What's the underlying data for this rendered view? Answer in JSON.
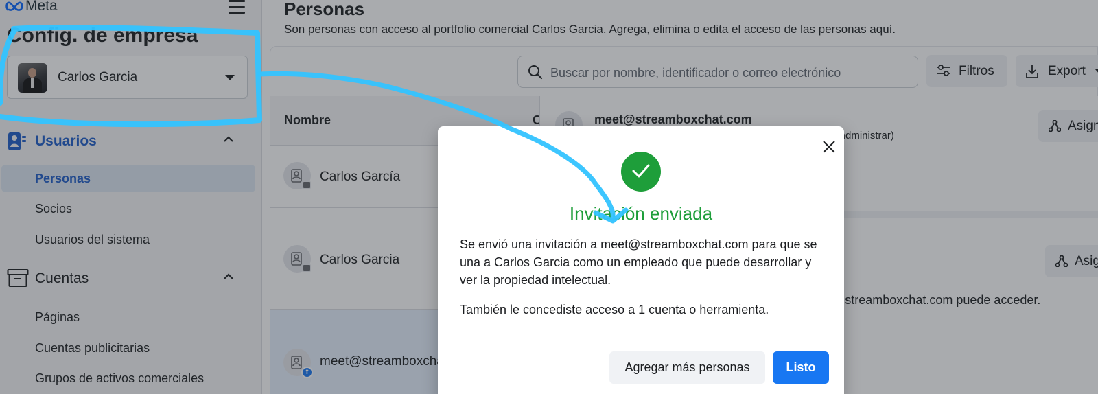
{
  "brand": {
    "name": "Meta"
  },
  "sidebar": {
    "title": "Config. de empresa",
    "business_selector": {
      "name": "Carlos Garcia"
    },
    "sections": [
      {
        "label": "Usuarios",
        "items": [
          "Personas",
          "Socios",
          "Usuarios del sistema"
        ]
      },
      {
        "label": "Cuentas",
        "items": [
          "Páginas",
          "Cuentas publicitarias",
          "Grupos de activos comerciales"
        ]
      }
    ],
    "active_item": "Personas"
  },
  "main": {
    "title": "Personas",
    "description": "Son personas con acceso al portfolio comercial Carlos Garcia. Agrega, elimina o edita el acceso de las personas aquí.",
    "search": {
      "placeholder": "Buscar por nombre, identificador o correo electrónico"
    },
    "filter_label": "Filtros",
    "export_label": "Export",
    "table": {
      "column_header": "Nombre",
      "column_header_2": "C",
      "rows": [
        {
          "name": "Carlos García",
          "badge": "business"
        },
        {
          "name": "Carlos Garcia",
          "badge": "business"
        },
        {
          "name": "meet@streamboxcha",
          "badge": "facebook",
          "selected": true
        }
      ]
    },
    "detail": {
      "email": "meet@streamboxchat.com",
      "role_tail": "ver y administrar)",
      "assign_label_1": "Asign",
      "assign_label_2": "Asig",
      "access_tail": "@streamboxchat.com puede acceder."
    }
  },
  "modal": {
    "title": "Invitación enviada",
    "body": "Se envió una invitación a meet@streamboxchat.com para que se una a Carlos Garcia como un empleado que puede desarrollar y ver la propiedad intelectual.",
    "note": "También le concediste acceso a 1 cuenta o herramienta.",
    "secondary_button": "Agregar más personas",
    "primary_button": "Listo"
  },
  "colors": {
    "accent_blue": "#1877f2",
    "active_nav_text": "#1d5cc8",
    "success_green": "#1e9e3a",
    "annotation_cyan": "#33c3ff"
  }
}
